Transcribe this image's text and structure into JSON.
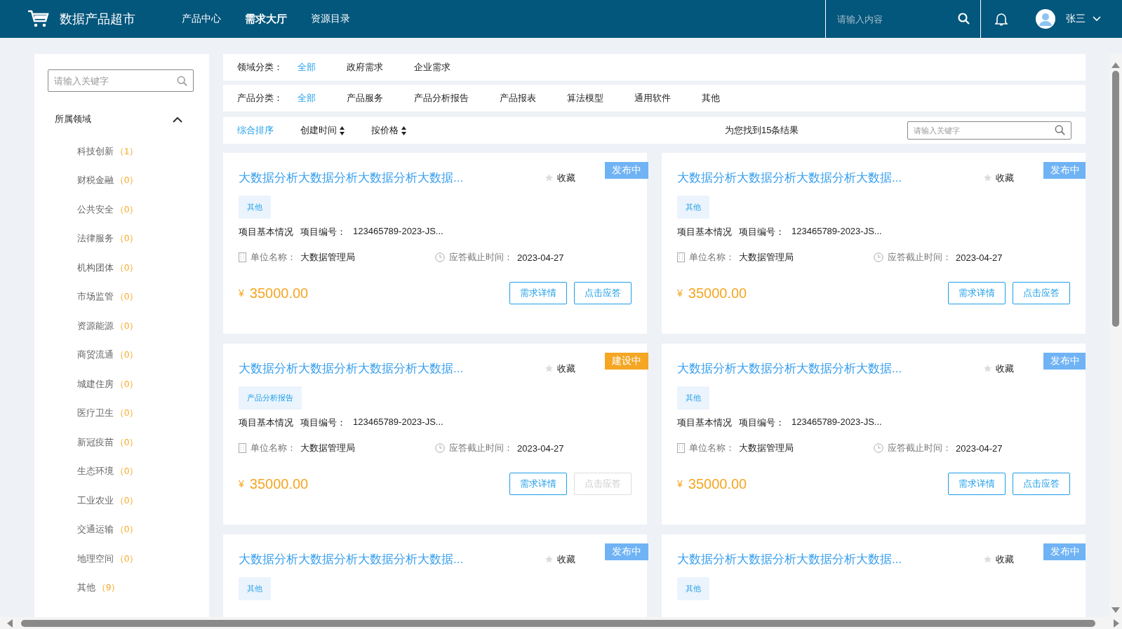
{
  "header": {
    "logo_text": "数据产品超市",
    "nav": [
      {
        "label": "产品中心",
        "selected": false
      },
      {
        "label": "需求大厅",
        "selected": true
      },
      {
        "label": "资源目录",
        "selected": false
      }
    ],
    "search": {
      "placeholder": "请输入内容"
    },
    "user": {
      "name": "张三"
    }
  },
  "sidebar": {
    "search": {
      "placeholder": "请输入关键字"
    },
    "section": {
      "title": "所属领域",
      "expanded": true,
      "items": [
        {
          "name": "科技创新",
          "count": "（1）"
        },
        {
          "name": "财税金融",
          "count": "（0）"
        },
        {
          "name": "公共安全",
          "count": "（0）"
        },
        {
          "name": "法律服务",
          "count": "（0）"
        },
        {
          "name": "机构团体",
          "count": "（0）"
        },
        {
          "name": "市场监管",
          "count": "（0）"
        },
        {
          "name": "资源能源",
          "count": "（0）"
        },
        {
          "name": "商贸流通",
          "count": "（0）"
        },
        {
          "name": "城建住房",
          "count": "（0）"
        },
        {
          "name": "医疗卫生",
          "count": "（0）"
        },
        {
          "name": "新冠疫苗",
          "count": "（0）"
        },
        {
          "name": "生态环境",
          "count": "（0）"
        },
        {
          "name": "工业农业",
          "count": "（0）"
        },
        {
          "name": "交通运输",
          "count": "（0）"
        },
        {
          "name": "地理空间",
          "count": "（0）"
        },
        {
          "name": "其他",
          "count": "（9）"
        }
      ]
    }
  },
  "filters": [
    {
      "label": "领域分类：",
      "options": [
        {
          "label": "全部",
          "selected": true
        },
        {
          "label": "政府需求",
          "selected": false
        },
        {
          "label": "企业需求",
          "selected": false
        }
      ]
    },
    {
      "label": "产品分类：",
      "options": [
        {
          "label": "全部",
          "selected": true
        },
        {
          "label": "产品服务",
          "selected": false
        },
        {
          "label": "产品分析报告",
          "selected": false
        },
        {
          "label": "产品报表",
          "selected": false
        },
        {
          "label": "算法模型",
          "selected": false
        },
        {
          "label": "通用软件",
          "selected": false
        },
        {
          "label": "其他",
          "selected": false
        }
      ]
    }
  ],
  "sort": {
    "options": [
      {
        "label": "综合排序",
        "selected": true,
        "sortable": false
      },
      {
        "label": "创建时间",
        "selected": false,
        "sortable": true
      },
      {
        "label": "按价格",
        "selected": false,
        "sortable": true
      }
    ],
    "result_text": "为您找到15条结果",
    "search": {
      "placeholder": "请输入关键字"
    }
  },
  "cards": [
    {
      "title": "大数据分析大数据分析大数据分析大数据...",
      "favorite": "收藏",
      "status": {
        "label": "发布中",
        "kind": "published"
      },
      "tag": "其他",
      "info": {
        "basic": "项目基本情况",
        "number_label": "项目编号：",
        "number": "123465789-2023-JS...",
        "unit_label": "单位名称：",
        "unit": "大数据管理局",
        "deadline_label": "应答截止时间：",
        "deadline": "2023-04-27"
      },
      "currency": "¥",
      "price": "35000.00",
      "buttons": [
        {
          "label": "需求详情",
          "disabled": false
        },
        {
          "label": "点击应答",
          "disabled": false
        }
      ]
    },
    {
      "title": "大数据分析大数据分析大数据分析大数据...",
      "favorite": "收藏",
      "status": {
        "label": "发布中",
        "kind": "published"
      },
      "tag": "其他",
      "info": {
        "basic": "项目基本情况",
        "number_label": "项目编号：",
        "number": "123465789-2023-JS...",
        "unit_label": "单位名称：",
        "unit": "大数据管理局",
        "deadline_label": "应答截止时间：",
        "deadline": "2023-04-27"
      },
      "currency": "¥",
      "price": "35000.00",
      "buttons": [
        {
          "label": "需求详情",
          "disabled": false
        },
        {
          "label": "点击应答",
          "disabled": false
        }
      ]
    },
    {
      "title": "大数据分析大数据分析大数据分析大数据...",
      "favorite": "收藏",
      "status": {
        "label": "建设中",
        "kind": "building"
      },
      "tag": "产品分析报告",
      "info": {
        "basic": "项目基本情况",
        "number_label": "项目编号：",
        "number": "123465789-2023-JS...",
        "unit_label": "单位名称：",
        "unit": "大数据管理局",
        "deadline_label": "应答截止时间：",
        "deadline": "2023-04-27"
      },
      "currency": "¥",
      "price": "35000.00",
      "buttons": [
        {
          "label": "需求详情",
          "disabled": false
        },
        {
          "label": "点击应答",
          "disabled": true
        }
      ]
    },
    {
      "title": "大数据分析大数据分析大数据分析大数据...",
      "favorite": "收藏",
      "status": {
        "label": "发布中",
        "kind": "published"
      },
      "tag": "其他",
      "info": {
        "basic": "项目基本情况",
        "number_label": "项目编号：",
        "number": "123465789-2023-JS...",
        "unit_label": "单位名称：",
        "unit": "大数据管理局",
        "deadline_label": "应答截止时间：",
        "deadline": "2023-04-27"
      },
      "currency": "¥",
      "price": "35000.00",
      "buttons": [
        {
          "label": "需求详情",
          "disabled": false
        },
        {
          "label": "点击应答",
          "disabled": false
        }
      ]
    },
    {
      "title": "大数据分析大数据分析大数据分析大数据...",
      "favorite": "收藏",
      "status": {
        "label": "发布中",
        "kind": "published"
      },
      "tag": "其他"
    },
    {
      "title": "大数据分析大数据分析大数据分析大数据...",
      "favorite": "收藏",
      "status": {
        "label": "发布中",
        "kind": "published"
      },
      "tag": "其他"
    }
  ]
}
